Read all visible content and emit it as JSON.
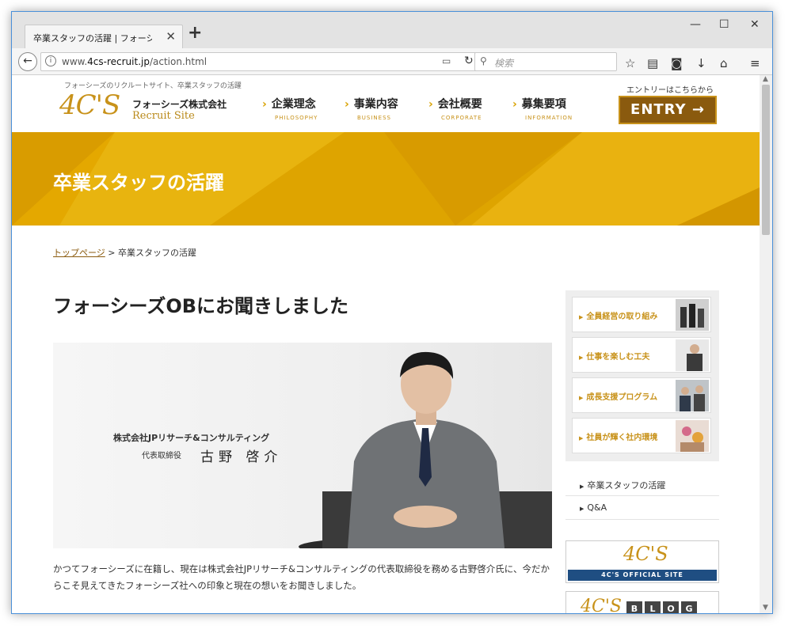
{
  "browser": {
    "tab_title": "卒業スタッフの活躍 | フォーシーズ...",
    "url_prefix": "www.",
    "url_domain": "4cs-recruit.jp",
    "url_path": "/action.html",
    "search_placeholder": "検索"
  },
  "site": {
    "tagline": "フォーシーズのリクルートサイト、卒業スタッフの活躍",
    "logo_mark": "4C'S",
    "logo_name": "フォーシーズ株式会社",
    "logo_sub": "Recruit Site",
    "nav": [
      {
        "label": "企業理念",
        "sub": "PHILOSOPHY"
      },
      {
        "label": "事業内容",
        "sub": "BUSINESS"
      },
      {
        "label": "会社概要",
        "sub": "CORPORATE"
      },
      {
        "label": "募集要項",
        "sub": "INFORMATION"
      }
    ],
    "entry_note": "エントリーはこちらから",
    "entry_label": "ENTRY →"
  },
  "banner": {
    "title": "卒業スタッフの活躍"
  },
  "breadcrumb": {
    "home": "トップページ",
    "separator": ">",
    "current": "卒業スタッフの活躍"
  },
  "main": {
    "title": "フォーシーズOBにお聞きしました",
    "hero_company": "株式会社JPリサーチ&コンサルティング",
    "hero_role": "代表取締役",
    "hero_name": "古野 啓介",
    "intro": "かつてフォーシーズに在籍し、現在は株式会社JPリサーチ&コンサルティングの代表取締役を務める古野啓介氏に、今だからこそ見えてきたフォーシーズ社への印象と現在の想いをお聞きしました。"
  },
  "sidebar": {
    "cards": [
      "全員経営の取り組み",
      "仕事を楽しむ工夫",
      "成長支援プログラム",
      "社員が輝く社内環境"
    ],
    "links": [
      "卒業スタッフの活躍",
      "Q&A"
    ],
    "official_mark": "4C'S",
    "official_label": "4C'S OFFICIAL SITE",
    "blog_mark": "4C'S",
    "blog_letters": [
      "B",
      "L",
      "O",
      "G"
    ]
  },
  "colors": {
    "accent": "#e4a800",
    "brand_gold": "#c8921a",
    "brand_dark": "#8a5a0e",
    "official_blue": "#1f4e82"
  }
}
